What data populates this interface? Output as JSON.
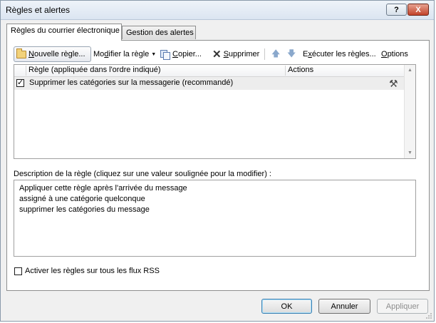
{
  "window": {
    "title": "Règles et alertes",
    "help_label": "?",
    "close_label": "X"
  },
  "tabs": [
    {
      "label": "Règles du courrier électronique",
      "active": true
    },
    {
      "label": "Gestion des alertes",
      "active": false
    }
  ],
  "toolbar": {
    "new_rule_prefix": "N",
    "new_rule_rest": "ouvelle règle...",
    "modify_prefix": "Mo",
    "modify_u": "d",
    "modify_rest": "ifier la règle",
    "copy_prefix": "C",
    "copy_rest": "opier...",
    "delete_u": "S",
    "delete_rest": "upprimer",
    "run_prefix": "E",
    "run_u": "x",
    "run_rest": "écuter les règles...",
    "options_prefix": "",
    "options_u": "O",
    "options_rest": "ptions"
  },
  "rules_table": {
    "columns": [
      "Règle (appliquée dans l'ordre indiqué)",
      "Actions"
    ],
    "rows": [
      {
        "checked": true,
        "name": "Supprimer les catégories sur la messagerie (recommandé)",
        "action_icon": "tools-icon"
      }
    ]
  },
  "description": {
    "label": "Description de la règle (cliquez sur une valeur soulignée pour la modifier) :",
    "lines": [
      "Appliquer cette règle après l'arrivée du message",
      "assigné à une catégorie quelconque",
      "supprimer les catégories du message"
    ]
  },
  "rss": {
    "checked": false,
    "label": "Activer les règles sur tous les flux RSS"
  },
  "buttons": {
    "ok": "OK",
    "cancel": "Annuler",
    "apply": "Appliquer"
  },
  "colors": {
    "selected_row": "#ededed",
    "default_button_border": "#3c7fb1",
    "close_button": "#c2432a"
  }
}
